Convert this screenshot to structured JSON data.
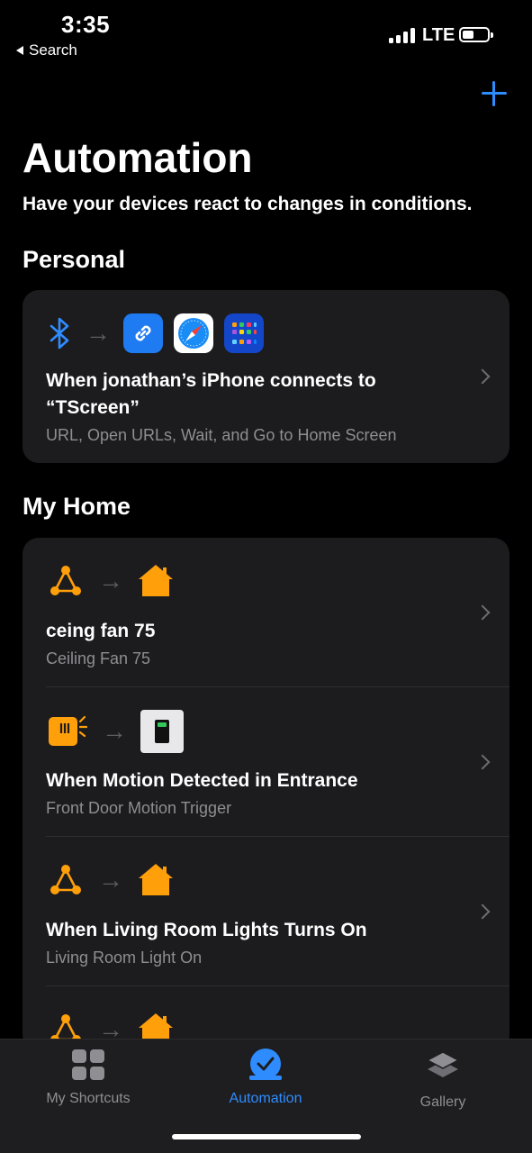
{
  "status": {
    "time": "3:35",
    "back_label": "Search",
    "network": "LTE",
    "battery_percent": 45
  },
  "header": {
    "title": "Automation",
    "subtitle": "Have your devices react to changes in conditions."
  },
  "colors": {
    "accent": "#2f8cff",
    "home_orange": "#ff9f0a",
    "card_bg": "#1c1c1e",
    "secondary_text": "#8e8e93"
  },
  "sections": [
    {
      "title": "Personal",
      "items": [
        {
          "trigger_icon": "bluetooth-icon",
          "action_icons": [
            "link-icon",
            "safari-icon",
            "home-screen-icon"
          ],
          "title": "When jonathan’s iPhone connects to “TScreen”",
          "subtitle": "URL, Open URLs, Wait, and Go to Home Screen"
        }
      ]
    },
    {
      "title": "My Home",
      "items": [
        {
          "trigger_icon": "accessory-network-icon",
          "action_icons": [
            "home-icon"
          ],
          "title": "ceing fan 75",
          "subtitle": "Ceiling Fan 75"
        },
        {
          "trigger_icon": "motion-sensor-icon",
          "action_icons": [
            "switch-icon"
          ],
          "title": "When Motion Detected in Entrance",
          "subtitle": "Front Door Motion Trigger"
        },
        {
          "trigger_icon": "accessory-network-icon",
          "action_icons": [
            "home-icon"
          ],
          "title": "When Living Room Lights Turns On",
          "subtitle": "Living Room Light On"
        },
        {
          "trigger_icon": "accessory-network-icon",
          "action_icons": [
            "home-icon"
          ],
          "title": "",
          "subtitle": ""
        }
      ]
    }
  ],
  "tabs": [
    {
      "label": "My Shortcuts",
      "icon": "grid-icon",
      "active": false
    },
    {
      "label": "Automation",
      "icon": "automation-check-icon",
      "active": true
    },
    {
      "label": "Gallery",
      "icon": "layers-icon",
      "active": false
    }
  ]
}
